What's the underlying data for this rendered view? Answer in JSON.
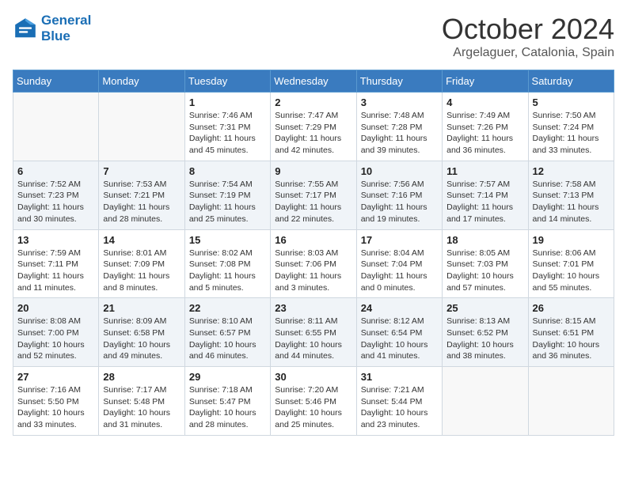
{
  "header": {
    "logo_line1": "General",
    "logo_line2": "Blue",
    "month": "October 2024",
    "location": "Argelaguer, Catalonia, Spain"
  },
  "weekdays": [
    "Sunday",
    "Monday",
    "Tuesday",
    "Wednesday",
    "Thursday",
    "Friday",
    "Saturday"
  ],
  "weeks": [
    [
      {
        "day": null
      },
      {
        "day": null
      },
      {
        "day": "1",
        "sunrise": "Sunrise: 7:46 AM",
        "sunset": "Sunset: 7:31 PM",
        "daylight": "Daylight: 11 hours and 45 minutes."
      },
      {
        "day": "2",
        "sunrise": "Sunrise: 7:47 AM",
        "sunset": "Sunset: 7:29 PM",
        "daylight": "Daylight: 11 hours and 42 minutes."
      },
      {
        "day": "3",
        "sunrise": "Sunrise: 7:48 AM",
        "sunset": "Sunset: 7:28 PM",
        "daylight": "Daylight: 11 hours and 39 minutes."
      },
      {
        "day": "4",
        "sunrise": "Sunrise: 7:49 AM",
        "sunset": "Sunset: 7:26 PM",
        "daylight": "Daylight: 11 hours and 36 minutes."
      },
      {
        "day": "5",
        "sunrise": "Sunrise: 7:50 AM",
        "sunset": "Sunset: 7:24 PM",
        "daylight": "Daylight: 11 hours and 33 minutes."
      }
    ],
    [
      {
        "day": "6",
        "sunrise": "Sunrise: 7:52 AM",
        "sunset": "Sunset: 7:23 PM",
        "daylight": "Daylight: 11 hours and 30 minutes."
      },
      {
        "day": "7",
        "sunrise": "Sunrise: 7:53 AM",
        "sunset": "Sunset: 7:21 PM",
        "daylight": "Daylight: 11 hours and 28 minutes."
      },
      {
        "day": "8",
        "sunrise": "Sunrise: 7:54 AM",
        "sunset": "Sunset: 7:19 PM",
        "daylight": "Daylight: 11 hours and 25 minutes."
      },
      {
        "day": "9",
        "sunrise": "Sunrise: 7:55 AM",
        "sunset": "Sunset: 7:17 PM",
        "daylight": "Daylight: 11 hours and 22 minutes."
      },
      {
        "day": "10",
        "sunrise": "Sunrise: 7:56 AM",
        "sunset": "Sunset: 7:16 PM",
        "daylight": "Daylight: 11 hours and 19 minutes."
      },
      {
        "day": "11",
        "sunrise": "Sunrise: 7:57 AM",
        "sunset": "Sunset: 7:14 PM",
        "daylight": "Daylight: 11 hours and 17 minutes."
      },
      {
        "day": "12",
        "sunrise": "Sunrise: 7:58 AM",
        "sunset": "Sunset: 7:13 PM",
        "daylight": "Daylight: 11 hours and 14 minutes."
      }
    ],
    [
      {
        "day": "13",
        "sunrise": "Sunrise: 7:59 AM",
        "sunset": "Sunset: 7:11 PM",
        "daylight": "Daylight: 11 hours and 11 minutes."
      },
      {
        "day": "14",
        "sunrise": "Sunrise: 8:01 AM",
        "sunset": "Sunset: 7:09 PM",
        "daylight": "Daylight: 11 hours and 8 minutes."
      },
      {
        "day": "15",
        "sunrise": "Sunrise: 8:02 AM",
        "sunset": "Sunset: 7:08 PM",
        "daylight": "Daylight: 11 hours and 5 minutes."
      },
      {
        "day": "16",
        "sunrise": "Sunrise: 8:03 AM",
        "sunset": "Sunset: 7:06 PM",
        "daylight": "Daylight: 11 hours and 3 minutes."
      },
      {
        "day": "17",
        "sunrise": "Sunrise: 8:04 AM",
        "sunset": "Sunset: 7:04 PM",
        "daylight": "Daylight: 11 hours and 0 minutes."
      },
      {
        "day": "18",
        "sunrise": "Sunrise: 8:05 AM",
        "sunset": "Sunset: 7:03 PM",
        "daylight": "Daylight: 10 hours and 57 minutes."
      },
      {
        "day": "19",
        "sunrise": "Sunrise: 8:06 AM",
        "sunset": "Sunset: 7:01 PM",
        "daylight": "Daylight: 10 hours and 55 minutes."
      }
    ],
    [
      {
        "day": "20",
        "sunrise": "Sunrise: 8:08 AM",
        "sunset": "Sunset: 7:00 PM",
        "daylight": "Daylight: 10 hours and 52 minutes."
      },
      {
        "day": "21",
        "sunrise": "Sunrise: 8:09 AM",
        "sunset": "Sunset: 6:58 PM",
        "daylight": "Daylight: 10 hours and 49 minutes."
      },
      {
        "day": "22",
        "sunrise": "Sunrise: 8:10 AM",
        "sunset": "Sunset: 6:57 PM",
        "daylight": "Daylight: 10 hours and 46 minutes."
      },
      {
        "day": "23",
        "sunrise": "Sunrise: 8:11 AM",
        "sunset": "Sunset: 6:55 PM",
        "daylight": "Daylight: 10 hours and 44 minutes."
      },
      {
        "day": "24",
        "sunrise": "Sunrise: 8:12 AM",
        "sunset": "Sunset: 6:54 PM",
        "daylight": "Daylight: 10 hours and 41 minutes."
      },
      {
        "day": "25",
        "sunrise": "Sunrise: 8:13 AM",
        "sunset": "Sunset: 6:52 PM",
        "daylight": "Daylight: 10 hours and 38 minutes."
      },
      {
        "day": "26",
        "sunrise": "Sunrise: 8:15 AM",
        "sunset": "Sunset: 6:51 PM",
        "daylight": "Daylight: 10 hours and 36 minutes."
      }
    ],
    [
      {
        "day": "27",
        "sunrise": "Sunrise: 7:16 AM",
        "sunset": "Sunset: 5:50 PM",
        "daylight": "Daylight: 10 hours and 33 minutes."
      },
      {
        "day": "28",
        "sunrise": "Sunrise: 7:17 AM",
        "sunset": "Sunset: 5:48 PM",
        "daylight": "Daylight: 10 hours and 31 minutes."
      },
      {
        "day": "29",
        "sunrise": "Sunrise: 7:18 AM",
        "sunset": "Sunset: 5:47 PM",
        "daylight": "Daylight: 10 hours and 28 minutes."
      },
      {
        "day": "30",
        "sunrise": "Sunrise: 7:20 AM",
        "sunset": "Sunset: 5:46 PM",
        "daylight": "Daylight: 10 hours and 25 minutes."
      },
      {
        "day": "31",
        "sunrise": "Sunrise: 7:21 AM",
        "sunset": "Sunset: 5:44 PM",
        "daylight": "Daylight: 10 hours and 23 minutes."
      },
      {
        "day": null
      },
      {
        "day": null
      }
    ]
  ]
}
